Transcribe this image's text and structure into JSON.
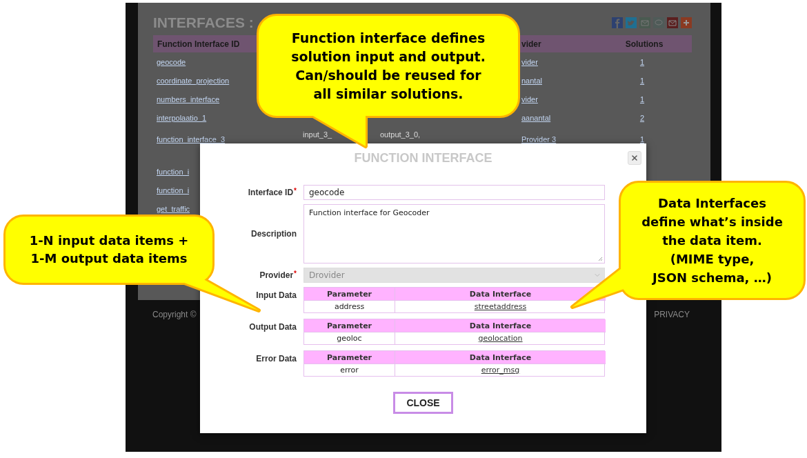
{
  "page": {
    "title": "INTERFACES :",
    "table": {
      "columns": [
        "Function Interface ID",
        "vider",
        "Solutions"
      ],
      "rows": [
        {
          "id": "geocode",
          "provider": "vider",
          "solutions": "1"
        },
        {
          "id": "coordinate_projection",
          "provider": "nantal",
          "solutions": "1"
        },
        {
          "id": "numbers_interface",
          "provider": "vider",
          "solutions": "1"
        },
        {
          "id": "interpolaatio_1",
          "provider": "aanantal",
          "solutions": "2"
        },
        {
          "id": "function_interface_3",
          "column_2": "input_3_",
          "column_3": "output_3_0,",
          "provider": "Provider 3",
          "solutions": "1"
        },
        {
          "id": "function_i"
        },
        {
          "id": "function_i"
        },
        {
          "id": "get_traffic"
        }
      ]
    },
    "footer": {
      "copyright": "Copyright ©",
      "privacy": "PRIVACY"
    }
  },
  "modal": {
    "title": "FUNCTION INTERFACE",
    "fields": [
      {
        "kind": "input",
        "label": "Interface ID",
        "required_mark": "*",
        "value": "geocode",
        "disabled": false
      },
      {
        "kind": "textarea",
        "label": "Description",
        "value": "Function interface for Geocoder",
        "disabled": false
      },
      {
        "kind": "select",
        "label": "Provider",
        "required_mark": "*",
        "value": "Drovider",
        "disabled": true
      }
    ],
    "data_tables": [
      {
        "label": "Input Data",
        "columns": [
          "Parameter",
          "Data Interface"
        ],
        "rows": [
          {
            "parameter": "address",
            "data_interface": "streetaddress"
          }
        ]
      },
      {
        "label": "Output Data",
        "columns": [
          "Parameter",
          "Data Interface"
        ],
        "rows": [
          {
            "parameter": "geoloc",
            "data_interface": "geolocation"
          }
        ]
      },
      {
        "label": "Error Data",
        "columns": [
          "Parameter",
          "Data Interface"
        ],
        "rows": [
          {
            "parameter": "error",
            "data_interface": "error_msg"
          }
        ]
      }
    ],
    "close_button": "CLOSE"
  },
  "callouts": [
    {
      "text": "Function interface defines\nsolution input and output.\nCan/should be reused for\nall similar solutions."
    },
    {
      "text": "1-N input data items +\n1-M output data items"
    },
    {
      "text": "Data Interfaces\ndefine what’s inside\nthe data item.\n(MIME type,\nJSON schema, …)"
    }
  ]
}
